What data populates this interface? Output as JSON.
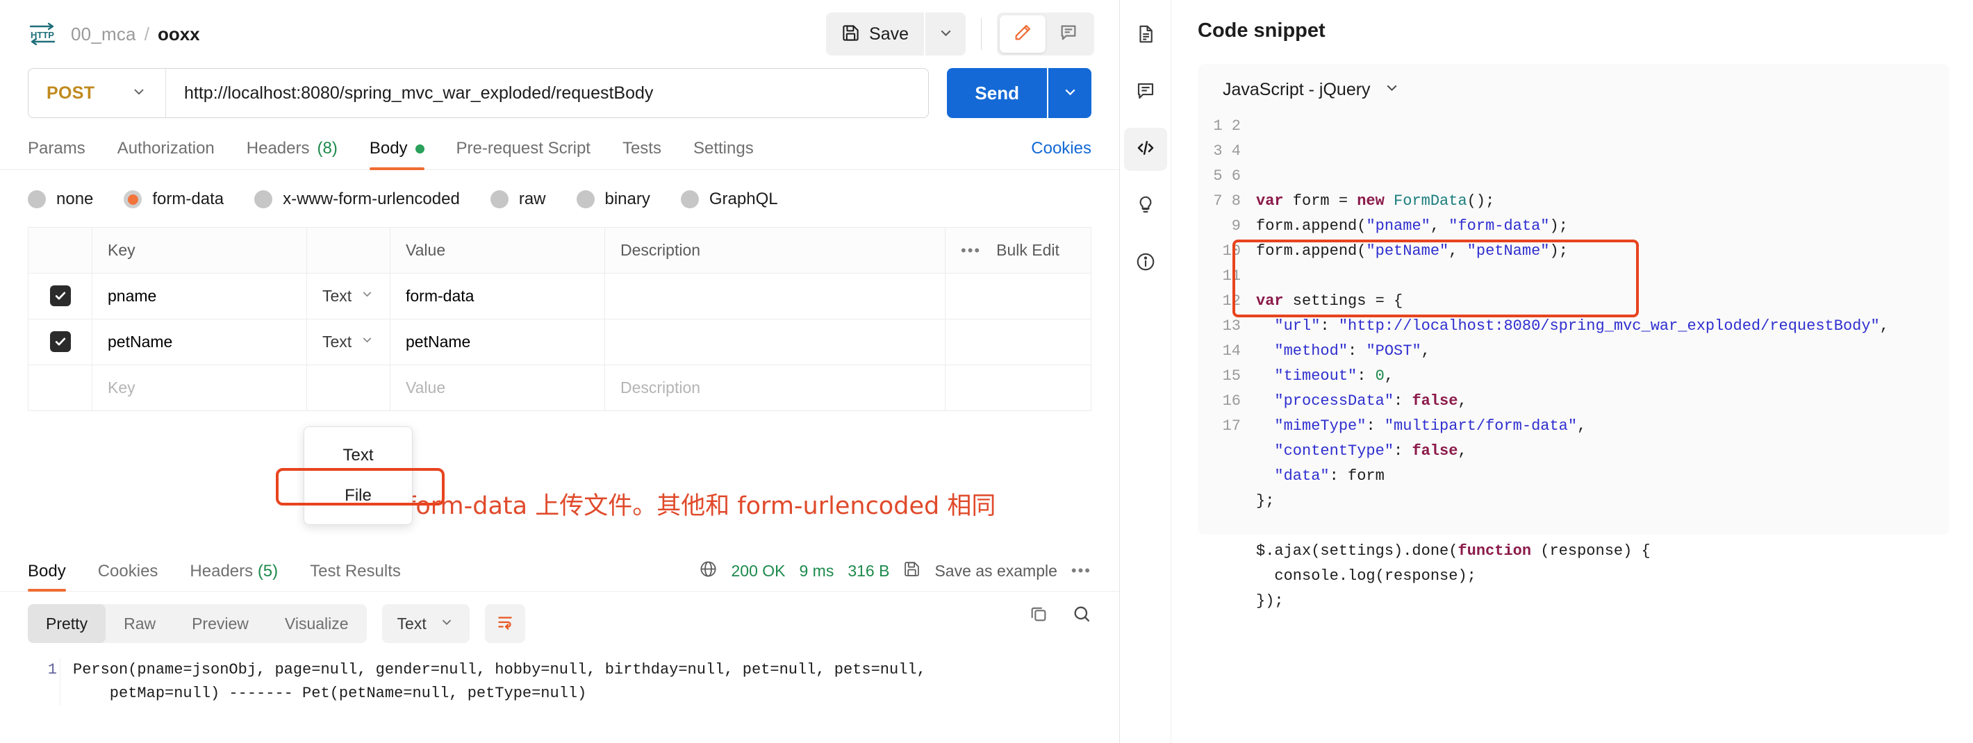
{
  "breadcrumb": {
    "icon": "http-icon",
    "collection": "00_mca",
    "separator": "/",
    "request_name": "ooxx"
  },
  "toolbar": {
    "save_label": "Save",
    "save_icon": "floppy-disk-icon",
    "save_caret_icon": "chevron-down-icon",
    "edit_icon": "pencil-icon",
    "comment_icon": "comment-icon"
  },
  "url_bar": {
    "method": "POST",
    "method_caret_icon": "chevron-down-icon",
    "url": "http://localhost:8080/spring_mvc_war_exploded/requestBody",
    "send_label": "Send",
    "send_caret_icon": "chevron-down-icon"
  },
  "request_tabs": {
    "items": [
      {
        "label": "Params",
        "active": false
      },
      {
        "label": "Authorization",
        "active": false
      },
      {
        "label": "Headers",
        "count": "(8)",
        "active": false
      },
      {
        "label": "Body",
        "dot": true,
        "active": true
      },
      {
        "label": "Pre-request Script",
        "active": false
      },
      {
        "label": "Tests",
        "active": false
      },
      {
        "label": "Settings",
        "active": false
      }
    ],
    "cookies_label": "Cookies"
  },
  "body_types": [
    {
      "label": "none",
      "selected": false
    },
    {
      "label": "form-data",
      "selected": true
    },
    {
      "label": "x-www-form-urlencoded",
      "selected": false
    },
    {
      "label": "raw",
      "selected": false
    },
    {
      "label": "binary",
      "selected": false
    },
    {
      "label": "GraphQL",
      "selected": false
    }
  ],
  "params_table": {
    "headers": {
      "key": "Key",
      "value": "Value",
      "description": "Description",
      "bulk_edit": "Bulk Edit",
      "dots_icon": "more-options-icon"
    },
    "rows": [
      {
        "checked": true,
        "key": "pname",
        "type": "Text",
        "value": "form-data",
        "description": ""
      },
      {
        "checked": true,
        "key": "petName",
        "type": "Text",
        "value": "petName",
        "description": ""
      }
    ],
    "empty_row": {
      "key_placeholder": "Key",
      "value_placeholder": "Value",
      "description_placeholder": "Description"
    }
  },
  "type_dropdown": {
    "options": [
      "Text",
      "File"
    ],
    "highlighted": "File",
    "highlight_color": "#e8441f"
  },
  "annotation": {
    "text": "form-data 上传文件。其他和 form-urlencoded 相同",
    "color": "#e04a2b"
  },
  "response": {
    "tabs": [
      {
        "label": "Body",
        "active": true
      },
      {
        "label": "Cookies",
        "active": false
      },
      {
        "label": "Headers",
        "count": "(5)",
        "active": false
      },
      {
        "label": "Test Results",
        "active": false
      }
    ],
    "meta": {
      "globe_icon": "globe-icon",
      "status": "200 OK",
      "time": "9 ms",
      "size": "316 B",
      "save_example_icon": "floppy-disk-icon",
      "save_example_label": "Save as example",
      "more_icon": "more-options-icon"
    },
    "format_tabs": [
      {
        "label": "Pretty",
        "active": true
      },
      {
        "label": "Raw",
        "active": false
      },
      {
        "label": "Preview",
        "active": false
      },
      {
        "label": "Visualize",
        "active": false
      }
    ],
    "format_select": "Text",
    "wrap_icon": "word-wrap-icon",
    "copy_icon": "copy-icon",
    "search_icon": "search-icon",
    "body_line_number": "1",
    "body_text": "Person(pname=jsonObj, page=null, gender=null, hobby=null, birthday=null, pet=null, pets=null,\n    petMap=null) ------- Pet(petName=null, petType=null)"
  },
  "right_rail": [
    {
      "icon": "document-icon",
      "active": false
    },
    {
      "icon": "comment-icon",
      "active": false
    },
    {
      "icon": "code-icon",
      "active": true
    },
    {
      "icon": "lightbulb-icon",
      "active": false
    },
    {
      "icon": "info-icon",
      "active": false
    }
  ],
  "code_snippet": {
    "title": "Code snippet",
    "language": "JavaScript - jQuery",
    "caret_icon": "chevron-down-icon",
    "highlight_color": "#e8441f",
    "highlight_lines": [
      9,
      10,
      11
    ],
    "lines": [
      {
        "n": 1,
        "tokens": [
          {
            "t": "var",
            "c": "kw"
          },
          {
            "t": " form = ",
            "c": "pln"
          },
          {
            "t": "new",
            "c": "kw"
          },
          {
            "t": " ",
            "c": "pln"
          },
          {
            "t": "FormData",
            "c": "cls"
          },
          {
            "t": "();",
            "c": "pln"
          }
        ]
      },
      {
        "n": 2,
        "tokens": [
          {
            "t": "form.append(",
            "c": "pln"
          },
          {
            "t": "\"pname\"",
            "c": "str"
          },
          {
            "t": ", ",
            "c": "pln"
          },
          {
            "t": "\"form-data\"",
            "c": "str"
          },
          {
            "t": ");",
            "c": "pln"
          }
        ]
      },
      {
        "n": 3,
        "tokens": [
          {
            "t": "form.append(",
            "c": "pln"
          },
          {
            "t": "\"petName\"",
            "c": "str"
          },
          {
            "t": ", ",
            "c": "pln"
          },
          {
            "t": "\"petName\"",
            "c": "str"
          },
          {
            "t": ");",
            "c": "pln"
          }
        ]
      },
      {
        "n": 4,
        "tokens": []
      },
      {
        "n": 5,
        "tokens": [
          {
            "t": "var",
            "c": "kw"
          },
          {
            "t": " settings = {",
            "c": "pln"
          }
        ]
      },
      {
        "n": 6,
        "tokens": [
          {
            "t": "  ",
            "c": "pln"
          },
          {
            "t": "\"url\"",
            "c": "str"
          },
          {
            "t": ": ",
            "c": "pln"
          },
          {
            "t": "\"http://localhost:8080/spring_mvc_war_exploded/requestBody\"",
            "c": "str"
          },
          {
            "t": ",",
            "c": "pln"
          }
        ]
      },
      {
        "n": 7,
        "tokens": [
          {
            "t": "  ",
            "c": "pln"
          },
          {
            "t": "\"method\"",
            "c": "str"
          },
          {
            "t": ": ",
            "c": "pln"
          },
          {
            "t": "\"POST\"",
            "c": "str"
          },
          {
            "t": ",",
            "c": "pln"
          }
        ]
      },
      {
        "n": 8,
        "tokens": [
          {
            "t": "  ",
            "c": "pln"
          },
          {
            "t": "\"timeout\"",
            "c": "str"
          },
          {
            "t": ": ",
            "c": "pln"
          },
          {
            "t": "0",
            "c": "num"
          },
          {
            "t": ",",
            "c": "pln"
          }
        ]
      },
      {
        "n": 9,
        "tokens": [
          {
            "t": "  ",
            "c": "pln"
          },
          {
            "t": "\"processData\"",
            "c": "str"
          },
          {
            "t": ": ",
            "c": "pln"
          },
          {
            "t": "false",
            "c": "kw"
          },
          {
            "t": ",",
            "c": "pln"
          }
        ]
      },
      {
        "n": 10,
        "tokens": [
          {
            "t": "  ",
            "c": "pln"
          },
          {
            "t": "\"mimeType\"",
            "c": "str"
          },
          {
            "t": ": ",
            "c": "pln"
          },
          {
            "t": "\"multipart/form-data\"",
            "c": "str"
          },
          {
            "t": ",",
            "c": "pln"
          }
        ]
      },
      {
        "n": 11,
        "tokens": [
          {
            "t": "  ",
            "c": "pln"
          },
          {
            "t": "\"contentType\"",
            "c": "str"
          },
          {
            "t": ": ",
            "c": "pln"
          },
          {
            "t": "false",
            "c": "kw"
          },
          {
            "t": ",",
            "c": "pln"
          }
        ]
      },
      {
        "n": 12,
        "tokens": [
          {
            "t": "  ",
            "c": "pln"
          },
          {
            "t": "\"data\"",
            "c": "str"
          },
          {
            "t": ": form",
            "c": "pln"
          }
        ]
      },
      {
        "n": 13,
        "tokens": [
          {
            "t": "};",
            "c": "pln"
          }
        ]
      },
      {
        "n": 14,
        "tokens": []
      },
      {
        "n": 15,
        "tokens": [
          {
            "t": "$.ajax(settings).done(",
            "c": "pln"
          },
          {
            "t": "function",
            "c": "kw"
          },
          {
            "t": " (response) {",
            "c": "pln"
          }
        ]
      },
      {
        "n": 16,
        "tokens": [
          {
            "t": "  console.log(response);",
            "c": "pln"
          }
        ]
      },
      {
        "n": 17,
        "tokens": [
          {
            "t": "});",
            "c": "pln"
          }
        ]
      }
    ]
  }
}
